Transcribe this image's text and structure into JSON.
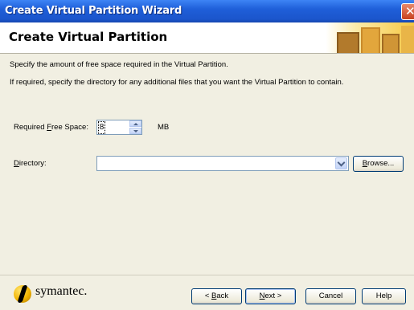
{
  "window": {
    "title": "Create Virtual Partition Wizard",
    "close_glyph": "✕"
  },
  "header": {
    "title": "Create Virtual Partition"
  },
  "content": {
    "instruction1": "Specify the amount of free space required in the Virtual Partition.",
    "instruction2": "If required, specify the directory for any additional files that you want the Virtual Partition to contain.",
    "free_space": {
      "label_pre": "Required ",
      "label_accel": "F",
      "label_post": "ree Space:",
      "value": "8",
      "unit": "MB"
    },
    "directory": {
      "label_accel": "D",
      "label_post": "irectory:",
      "value": "",
      "browse_accel": "B",
      "browse_post": "rowse..."
    }
  },
  "footer": {
    "logo_text": "symantec.",
    "back_pre": "< ",
    "back_accel": "B",
    "back_post": "ack",
    "next_accel": "N",
    "next_post": "ext >",
    "cancel": "Cancel",
    "help": "Help"
  },
  "colors": {
    "titlebar": "#1f5fd9",
    "background": "#f1efe2",
    "accent_logo": "#f2b400"
  }
}
